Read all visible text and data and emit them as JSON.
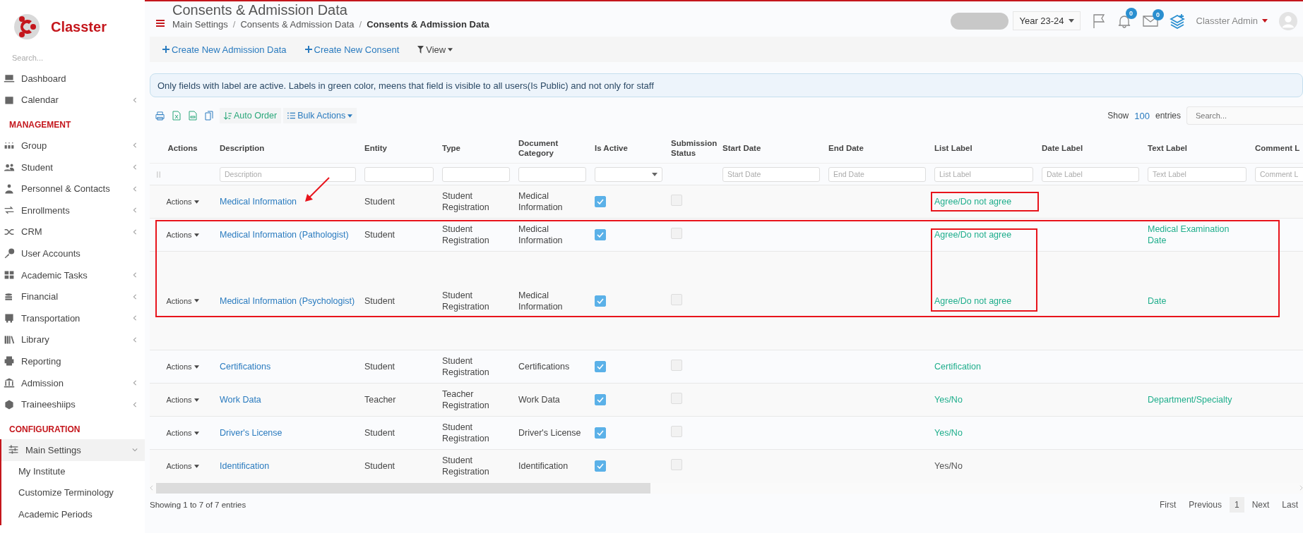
{
  "sidebar": {
    "brand": "Classter",
    "search": {
      "placeholder": "Search..."
    },
    "sections": [
      {
        "items": [
          {
            "label": "Dashboard",
            "has_submenu": false,
            "selected": false
          },
          {
            "label": "Calendar",
            "has_submenu": true,
            "selected": false
          }
        ]
      },
      {
        "heading": "MANAGEMENT",
        "items": [
          {
            "label": "Group",
            "has_submenu": true,
            "selected": false
          },
          {
            "label": "Student",
            "has_submenu": true,
            "selected": false
          },
          {
            "label": "Personnel & Contacts",
            "has_submenu": true,
            "selected": false
          },
          {
            "label": "Enrollments",
            "has_submenu": true,
            "selected": false
          },
          {
            "label": "CRM",
            "has_submenu": true,
            "selected": false
          },
          {
            "label": "User Accounts",
            "has_submenu": false,
            "selected": false
          },
          {
            "label": "Academic Tasks",
            "has_submenu": true,
            "selected": false
          },
          {
            "label": "Financial",
            "has_submenu": true,
            "selected": false
          },
          {
            "label": "Transportation",
            "has_submenu": true,
            "selected": false
          },
          {
            "label": "Library",
            "has_submenu": true,
            "selected": false
          },
          {
            "label": "Reporting",
            "has_submenu": false,
            "selected": false
          },
          {
            "label": "Admission",
            "has_submenu": true,
            "selected": false
          },
          {
            "label": "Traineeshiips",
            "has_submenu": true,
            "selected": false
          }
        ]
      },
      {
        "heading": "CONFIGURATION",
        "items": [
          {
            "label": "Main Settings",
            "has_submenu": true,
            "selected": true,
            "expanded": true,
            "children": [
              {
                "label": "My Institute"
              },
              {
                "label": "Customize Terminology"
              },
              {
                "label": "Academic Periods"
              }
            ]
          }
        ]
      }
    ]
  },
  "header": {
    "title": "Consents & Admission Data",
    "breadcrumb": [
      "Main Settings",
      "Consents & Admission Data",
      "Consents & Admission Data"
    ],
    "breadcrumb_separators": [
      "/",
      "/"
    ],
    "year": "Year 23-24",
    "notifications": "0",
    "messages": "0",
    "user": "Classter Admin"
  },
  "toolbar": [
    {
      "label": "Create New Admission Data",
      "kind": "create"
    },
    {
      "label": "Create New Consent",
      "kind": "create"
    },
    {
      "label": "View",
      "kind": "view"
    }
  ],
  "info": "Only fields with label are active. Labels in green color, meens that field is visible to all users(Is Public) and not only for staff",
  "table_tools": {
    "auto_order": "Auto Order",
    "bulk_actions": "Bulk Actions",
    "show": "Show",
    "page_size": "100",
    "entries": "entries",
    "search_placeholder": "Search..."
  },
  "table": {
    "columns": [
      {
        "label": "Actions"
      },
      {
        "label": "Description",
        "filter": {
          "kind": "text",
          "placeholder": "Description"
        }
      },
      {
        "label": "Entity",
        "filter": {
          "kind": "text"
        }
      },
      {
        "label": "Type",
        "filter": {
          "kind": "text"
        }
      },
      {
        "label": "Document Category",
        "filter": {
          "kind": "text"
        }
      },
      {
        "label": "Is Active",
        "filter": {
          "kind": "select"
        }
      },
      {
        "label": "Submission Status"
      },
      {
        "label": "Start Date",
        "filter": {
          "kind": "text",
          "placeholder": "Start Date"
        }
      },
      {
        "label": "End Date",
        "filter": {
          "kind": "text",
          "placeholder": "End Date"
        }
      },
      {
        "label": "List Label",
        "filter": {
          "kind": "text",
          "placeholder": "List Label"
        }
      },
      {
        "label": "Date Label",
        "filter": {
          "kind": "text",
          "placeholder": "Date Label"
        }
      },
      {
        "label": "Text Label",
        "filter": {
          "kind": "text",
          "placeholder": "Text Label"
        }
      },
      {
        "label": "Comment L",
        "filter": {
          "kind": "text",
          "placeholder": "Comment L"
        }
      }
    ],
    "rows": [
      {
        "actions": "Actions",
        "description": "Medical Information",
        "entity": "Student",
        "type": "Student Registration",
        "category": "Medical Information",
        "is_active": true,
        "submission_status": false,
        "list_label": {
          "text": "Agree/Do not agree",
          "public": true
        },
        "text_label": null
      },
      {
        "actions": "Actions",
        "description": "Medical Information (Pathologist)",
        "entity": "Student",
        "type": "Student Registration",
        "category": "Medical Information",
        "is_active": true,
        "submission_status": false,
        "list_label": {
          "text": "Agree/Do not agree",
          "public": true
        },
        "text_label": {
          "text": "Medical Examination Date",
          "public": true
        }
      },
      {
        "actions": "Actions",
        "description": "Medical Information (Psychologist)",
        "entity": "Student",
        "type": "Student Registration",
        "category": "Medical Information",
        "is_active": true,
        "submission_status": false,
        "list_label": {
          "text": "Agree/Do not agree",
          "public": true
        },
        "text_label": {
          "text": "Date",
          "public": true
        }
      },
      {
        "actions": "Actions",
        "description": "Certifications",
        "entity": "Student",
        "type": "Student Registration",
        "category": "Certifications",
        "is_active": true,
        "submission_status": false,
        "list_label": {
          "text": "Certification",
          "public": true
        },
        "text_label": null
      },
      {
        "actions": "Actions",
        "description": "Work Data",
        "entity": "Teacher",
        "type": "Teacher Registration",
        "category": "Work Data",
        "is_active": true,
        "submission_status": false,
        "list_label": {
          "text": "Yes/No",
          "public": true
        },
        "text_label": {
          "text": "Department/Specialty",
          "public": true
        }
      },
      {
        "actions": "Actions",
        "description": "Driver's License",
        "entity": "Student",
        "type": "Student Registration",
        "category": "Driver's License",
        "is_active": true,
        "submission_status": false,
        "list_label": {
          "text": "Yes/No",
          "public": true
        },
        "text_label": null
      },
      {
        "actions": "Actions",
        "description": "Identification",
        "entity": "Student",
        "type": "Student Registration",
        "category": "Identification",
        "is_active": true,
        "submission_status": false,
        "list_label": {
          "text": "Yes/No",
          "public": false
        },
        "text_label": null
      }
    ]
  },
  "footer": {
    "summary": "Showing 1 to 7 of 7 entries",
    "pages": [
      {
        "label": "First",
        "selected": false
      },
      {
        "label": "Previous",
        "selected": false
      },
      {
        "label": "1",
        "selected": true
      },
      {
        "label": "Next",
        "selected": false
      },
      {
        "label": "Last",
        "selected": false
      }
    ]
  }
}
